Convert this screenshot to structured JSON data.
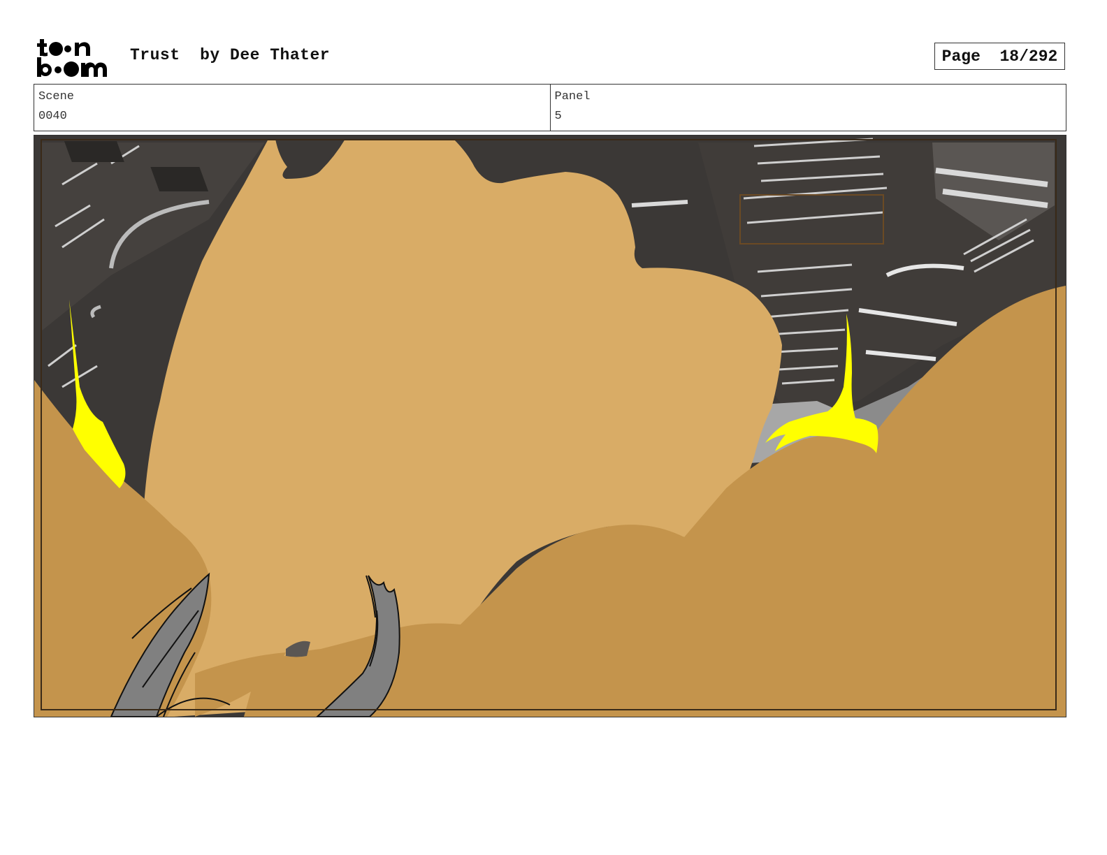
{
  "header": {
    "logo_top": "to•n",
    "logo_bottom": "b••m",
    "title": "Trust",
    "author": "by Dee Thater",
    "page_label": "Page",
    "page_value": "18/292"
  },
  "info": {
    "scene_label": "Scene",
    "scene_value": "0040",
    "panel_label": "Panel",
    "panel_value": "5"
  },
  "colors": {
    "tan_light": "#d9ac66",
    "tan_dark": "#c4944c",
    "interior_dark": "#3b3836",
    "yellow": "#ffff00",
    "claw_gray": "#808080"
  }
}
